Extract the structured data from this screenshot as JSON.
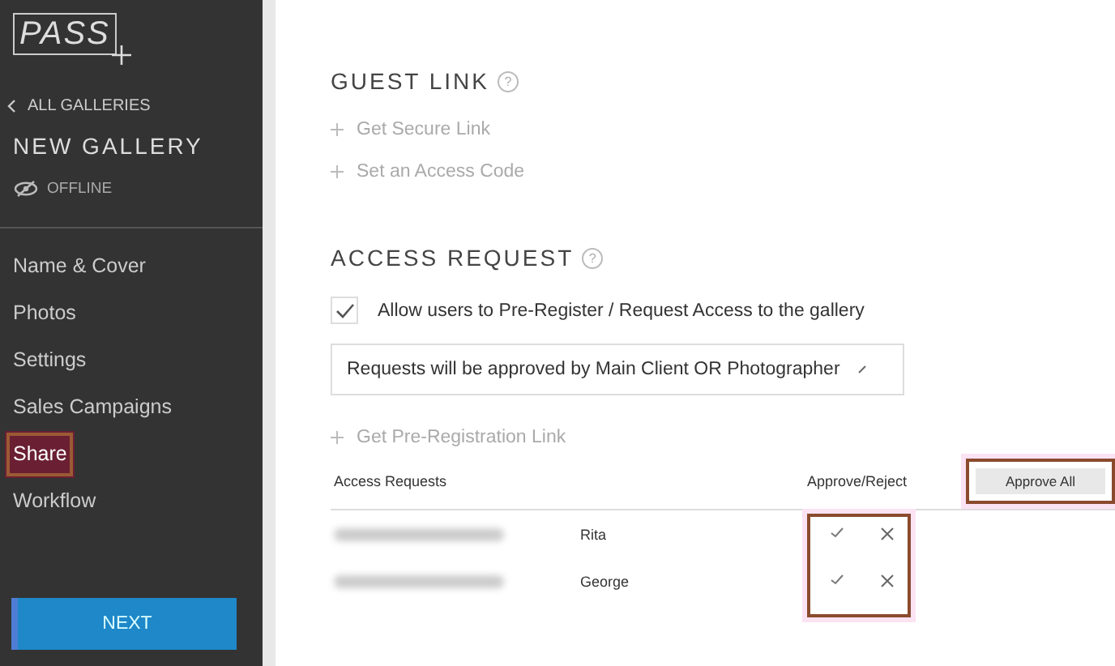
{
  "sidebar": {
    "logo": "PASS",
    "back_link": "ALL GALLERIES",
    "gallery_title": "NEW GALLERY",
    "status": "OFFLINE",
    "items": [
      {
        "label": "Name & Cover",
        "selected": false
      },
      {
        "label": "Photos",
        "selected": false
      },
      {
        "label": "Settings",
        "selected": false
      },
      {
        "label": "Sales Campaigns",
        "selected": false
      },
      {
        "label": "Share",
        "selected": true
      },
      {
        "label": "Workflow",
        "selected": false
      }
    ],
    "next_button": "NEXT"
  },
  "guest_link": {
    "title": "GUEST LINK",
    "help_icon": "?",
    "actions": [
      "Get Secure Link",
      "Set an Access Code"
    ]
  },
  "access_request": {
    "title": "ACCESS REQUEST",
    "help_icon": "?",
    "allow_checkbox": {
      "label": "Allow users to Pre-Register / Request Access to the gallery",
      "checked": true
    },
    "approval_select": "Requests will be approved by Main Client OR Photographer",
    "pre_registration_action": "Get Pre-Registration Link",
    "table": {
      "columns": [
        "Access Requests",
        "Approve/Reject"
      ],
      "approve_all_button": "Approve All",
      "rows": [
        {
          "name": "Rita"
        },
        {
          "name": "George"
        }
      ]
    }
  }
}
